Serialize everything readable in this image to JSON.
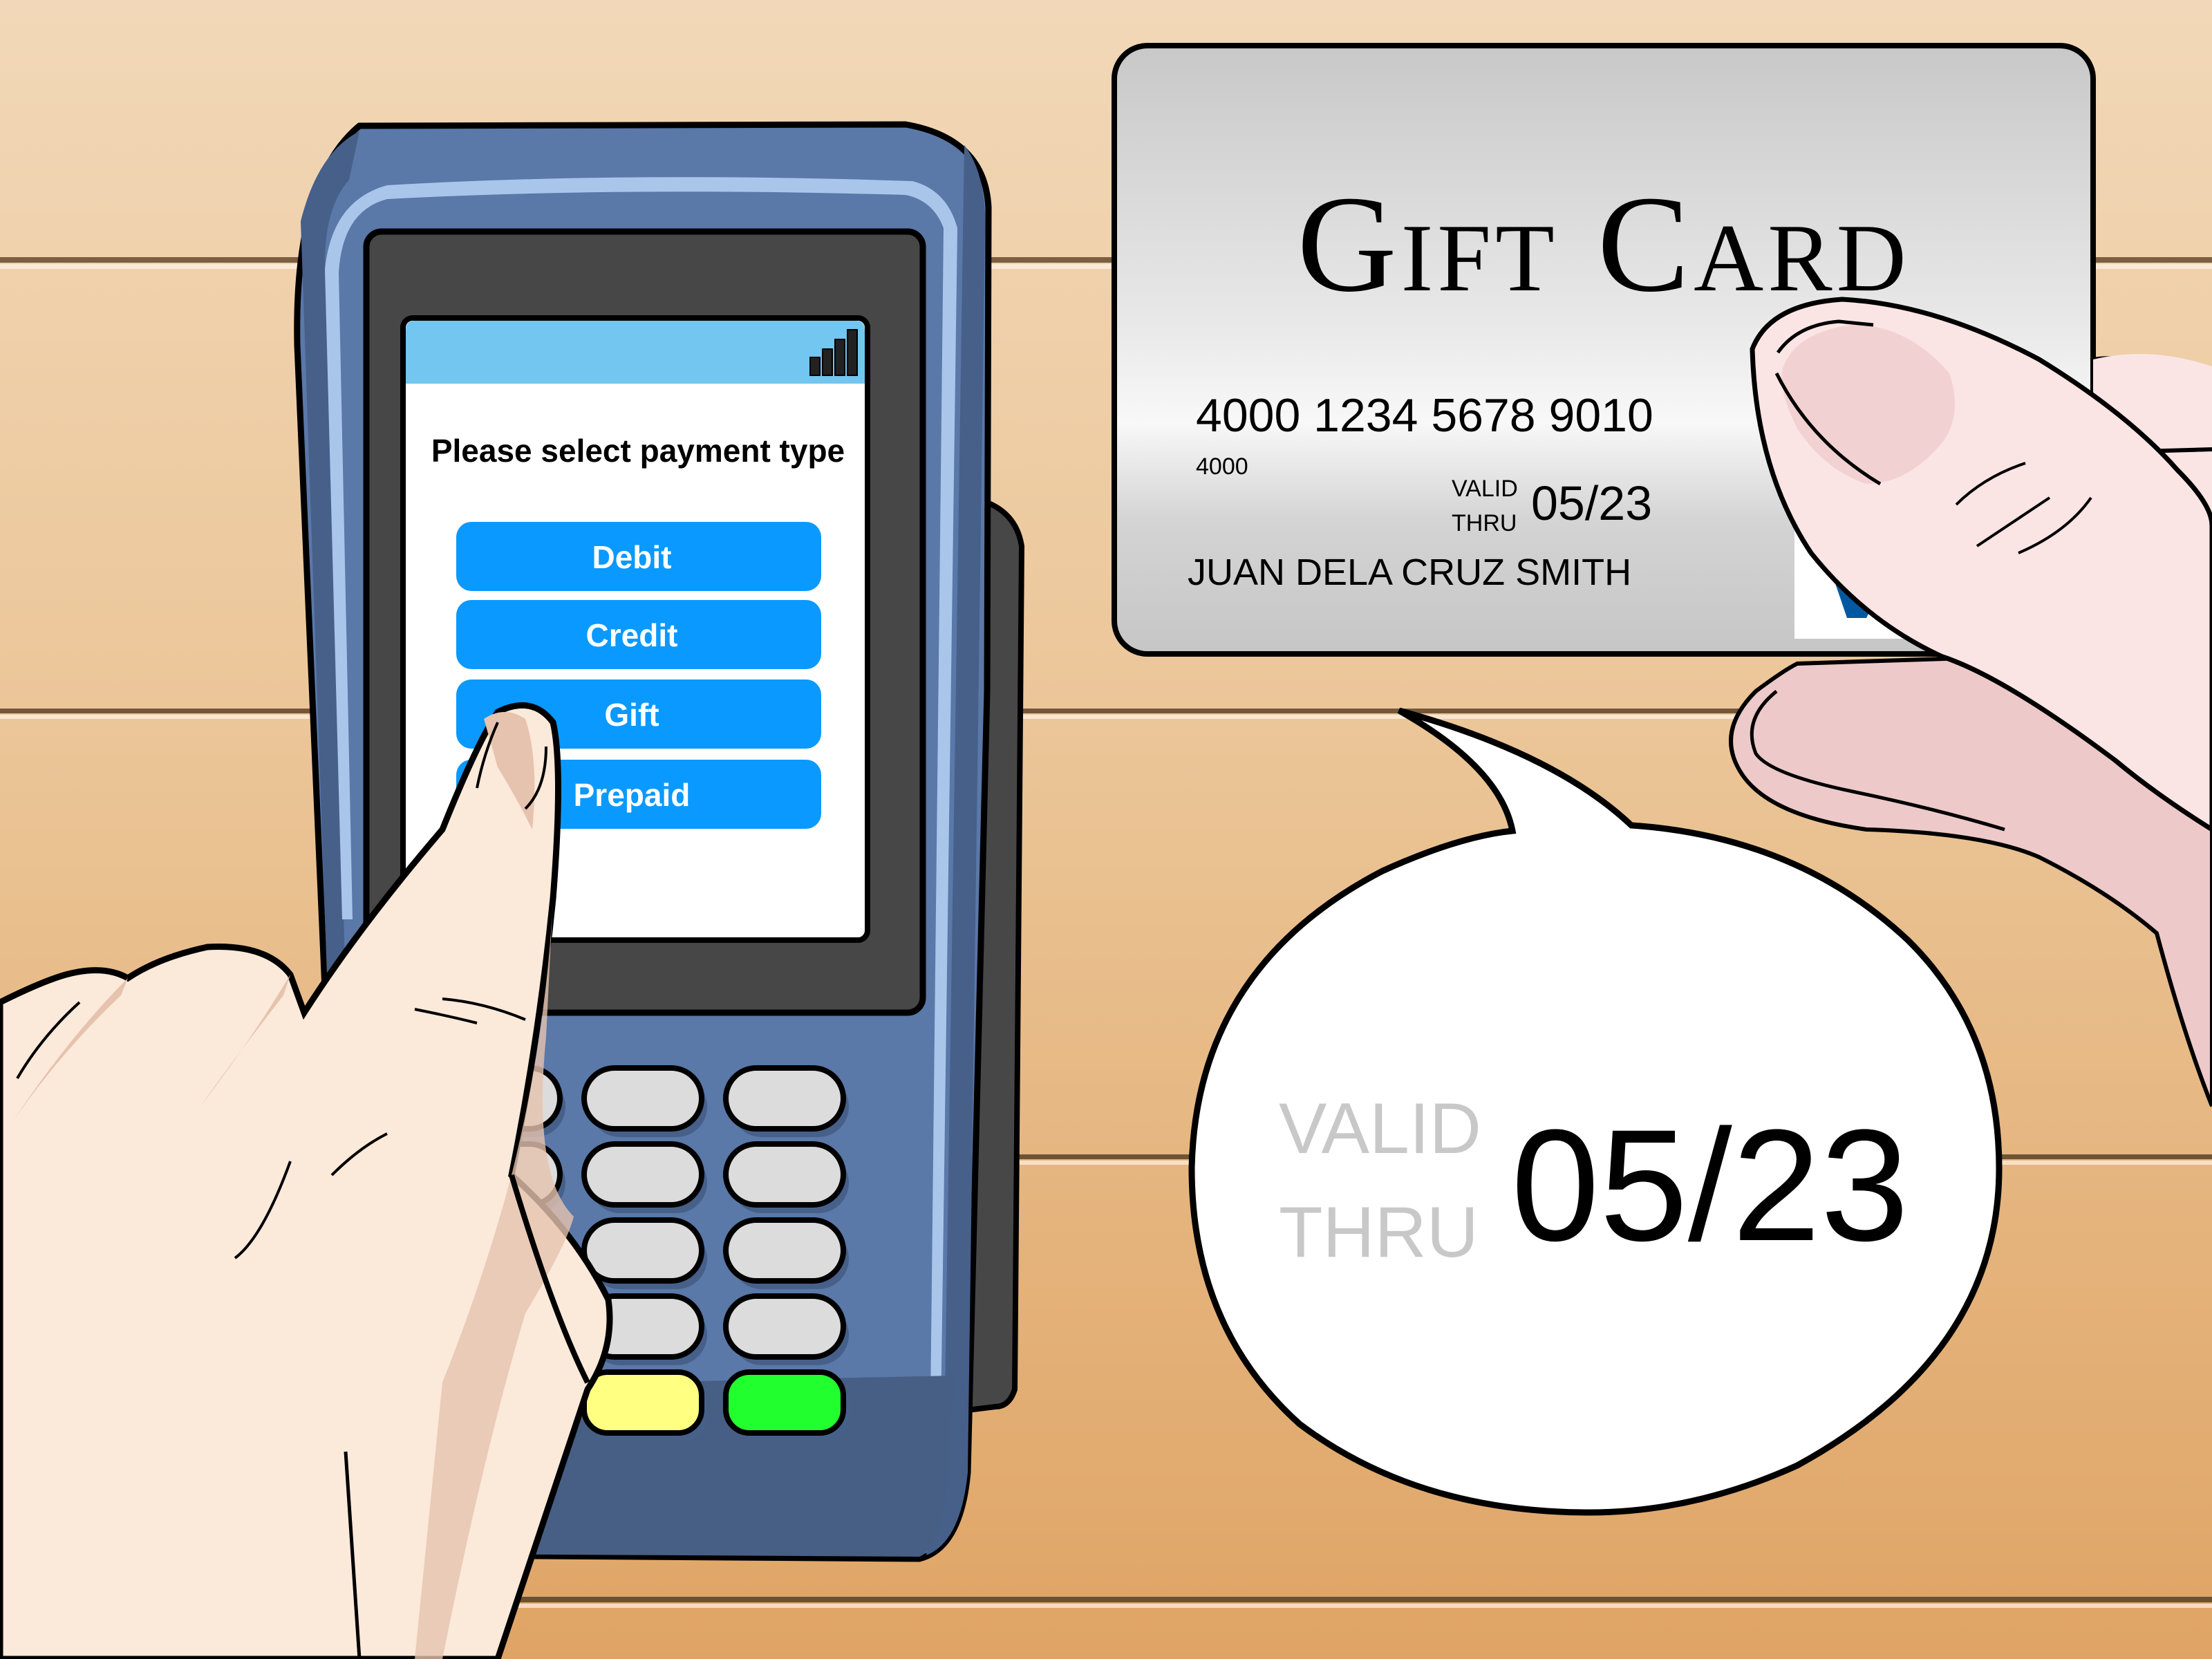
{
  "scene": {
    "description": "Illustration of a hand tapping a payment terminal screen while another hand holds a gift card",
    "colors": {
      "wood_top": "#F2D8B8",
      "wood_bottom": "#DFA465",
      "groove_dark": "#6E5436",
      "groove_light": "#FAE8D4",
      "terminal_body": "#5A78A8",
      "terminal_shadow": "#46608A",
      "terminal_highlight": "#A9C6EA",
      "bezel": "#474747",
      "screen_header": "#72C6EF",
      "screen_bg": "#FFFFFF",
      "button_blue": "#0A99FF",
      "key_gray": "#DCDCDC",
      "key_red": "#E5242A",
      "key_yellow": "#FFFF82",
      "key_green": "#22FF2E",
      "card_silver_light": "#F6F6F6",
      "card_silver_dark": "#C8C8C8",
      "skin_left": "#FBE9DA",
      "skin_left_shade": "#E6C3AE",
      "skin_right": "#FBE4E4",
      "skin_right_shade": "#EDC9C9",
      "visa_blue": "#0059A0",
      "visa_gold": "#F5A623",
      "valid_gray": "#C8C8C8"
    }
  },
  "terminal": {
    "status_icon": "signal-strength-icon",
    "signal_bars": 4,
    "prompt": "Please select payment type",
    "options": [
      {
        "label": "Debit"
      },
      {
        "label": "Credit"
      },
      {
        "label": "Gift",
        "selected": true
      },
      {
        "label": "Prepaid"
      }
    ],
    "keypad": {
      "numeric_rows": 4,
      "numeric_cols": 3,
      "function_keys": [
        "cancel-red",
        "clear-yellow",
        "enter-green"
      ]
    }
  },
  "gift_card": {
    "title": "Gift Card",
    "number": "4000 1234 5678 9010",
    "bin": "4000",
    "valid_label_1": "VALID",
    "valid_label_2": "THRU",
    "expiry": "05/23",
    "holder": "JUAN DELA CRUZ SMITH",
    "network_logo": "visa-logo",
    "network_letter": "V"
  },
  "callout": {
    "valid_label_1": "VALID",
    "valid_label_2": "THRU",
    "expiry": "05/23"
  }
}
